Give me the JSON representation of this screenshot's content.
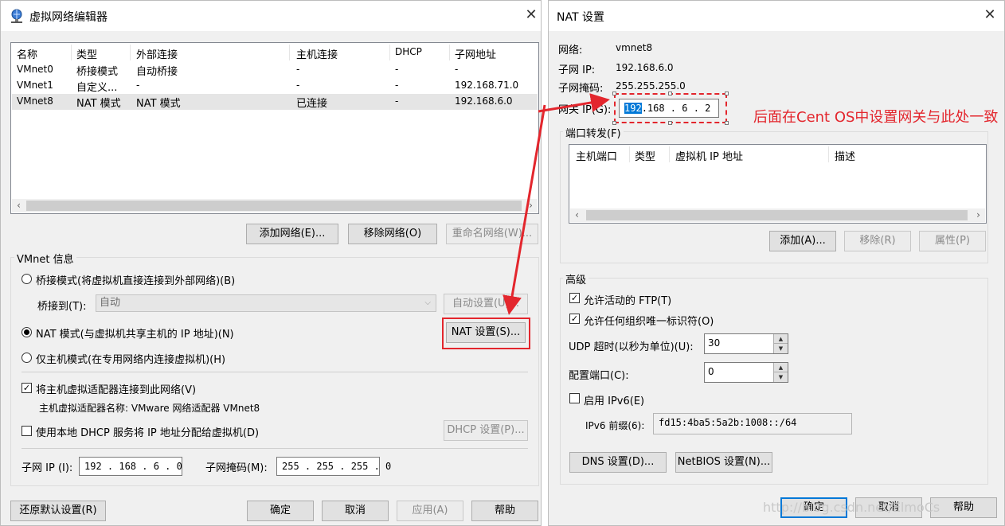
{
  "left_dialog": {
    "title": "虚拟网络编辑器",
    "table": {
      "headers": [
        "名称",
        "类型",
        "外部连接",
        "主机连接",
        "DHCP",
        "子网地址"
      ],
      "rows": [
        [
          "VMnet0",
          "桥接模式",
          "自动桥接",
          "-",
          "-",
          "-"
        ],
        [
          "VMnet1",
          "自定义...",
          "-",
          "-",
          "-",
          "192.168.71.0"
        ],
        [
          "VMnet8",
          "NAT 模式",
          "NAT 模式",
          "已连接",
          "-",
          "192.168.6.0"
        ]
      ]
    },
    "buttons": {
      "add_network": "添加网络(E)...",
      "remove_network": "移除网络(O)",
      "rename_network": "重命名网络(W)..."
    },
    "vmnet_info": {
      "title": "VMnet 信息",
      "bridged_label": "桥接模式(将虚拟机直接连接到外部网络)(B)",
      "bridge_to_label": "桥接到(T):",
      "bridge_to_value": "自动",
      "auto_settings": "自动设置(U)...",
      "nat_label": "NAT 模式(与虚拟机共享主机的 IP 地址)(N)",
      "nat_settings": "NAT 设置(S)...",
      "host_only_label": "仅主机模式(在专用网络内连接虚拟机)(H)",
      "connect_adapter_label": "将主机虚拟适配器连接到此网络(V)",
      "adapter_name_label": "主机虚拟适配器名称: VMware 网络适配器 VMnet8",
      "dhcp_label": "使用本地 DHCP 服务将 IP 地址分配给虚拟机(D)",
      "dhcp_settings": "DHCP 设置(P)...",
      "subnet_ip_label": "子网 IP (I):",
      "subnet_ip_value": "192 . 168 .  6  .  0",
      "subnet_mask_label": "子网掩码(M):",
      "subnet_mask_value": "255 . 255 . 255 .  0"
    },
    "footer": {
      "restore": "还原默认设置(R)",
      "ok": "确定",
      "cancel": "取消",
      "apply": "应用(A)",
      "help": "帮助"
    }
  },
  "nat_dialog": {
    "title": "NAT 设置",
    "network_label": "网络:",
    "network_value": "vmnet8",
    "subnet_ip_label": "子网 IP:",
    "subnet_ip_value": "192.168.6.0",
    "subnet_mask_label": "子网掩码:",
    "subnet_mask_value": "255.255.255.0",
    "gateway_label": "网关 IP(G):",
    "gateway_selected": "192",
    "gateway_rest": ".168 . 6  . 2",
    "port_forwarding": {
      "title": "端口转发(F)",
      "headers": [
        "主机端口",
        "类型",
        "虚拟机 IP 地址",
        "描述"
      ],
      "add": "添加(A)...",
      "remove": "移除(R)",
      "properties": "属性(P)"
    },
    "advanced": {
      "title": "高级",
      "ftp_label": "允许活动的 FTP(T)",
      "org_id_label": "允许任何组织唯一标识符(O)",
      "udp_timeout_label": "UDP 超时(以秒为单位)(U):",
      "udp_timeout_value": "30",
      "config_port_label": "配置端口(C):",
      "config_port_value": "0",
      "ipv6_label": "启用 IPv6(E)",
      "ipv6_prefix_label": "IPv6 前缀(6):",
      "ipv6_prefix_value": "fd15:4ba5:5a2b:1008::/64",
      "dns_settings": "DNS 设置(D)...",
      "netbios_settings": "NetBIOS 设置(N)..."
    },
    "footer": {
      "ok": "确定",
      "cancel": "取消",
      "help": "帮助"
    }
  },
  "annotation": {
    "text": "后面在Cent OS中设置网关与此处一致",
    "color": "#e3262d"
  },
  "watermark": "http://blog.csdn.net/ElmoCs",
  "colors": {
    "accent": "#0078d7",
    "annotation": "#e3262d",
    "dialog_bg": "#f0f0f0"
  }
}
